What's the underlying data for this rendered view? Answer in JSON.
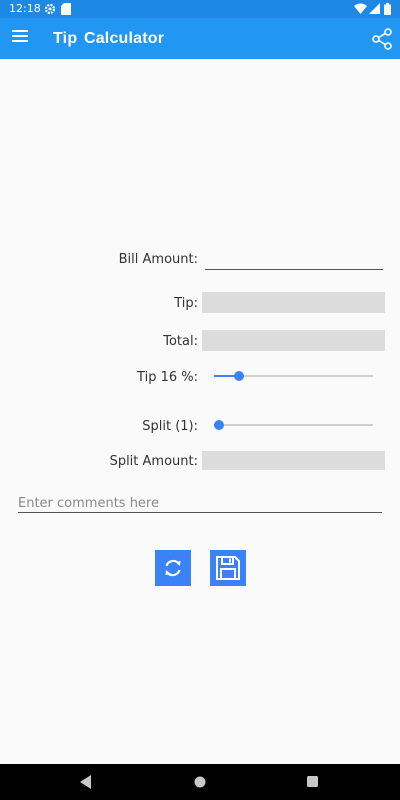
{
  "status_bar": {
    "time": "12:18"
  },
  "app_bar": {
    "title": "Tip  Calculator"
  },
  "form": {
    "bill_amount_label": "Bill Amount:",
    "bill_amount_value": "",
    "tip_label": "Tip:",
    "tip_value": "",
    "total_label": "Total:",
    "total_value": "",
    "tip_percent_label": "Tip 16 %:",
    "tip_percent": 16,
    "split_label": "Split (1):",
    "split": 1,
    "split_amount_label": "Split Amount:",
    "split_amount_value": "",
    "comments_placeholder": "Enter comments here"
  },
  "colors": {
    "status_bar": "#1e88e5",
    "app_bar": "#2196f3",
    "accent": "#3b82f6"
  },
  "icons": [
    "settings-icon",
    "sd-card-icon",
    "wifi-icon",
    "signal-icon",
    "battery-icon",
    "menu-icon",
    "share-icon",
    "refresh-icon",
    "save-icon",
    "back-icon",
    "home-icon",
    "recents-icon"
  ]
}
